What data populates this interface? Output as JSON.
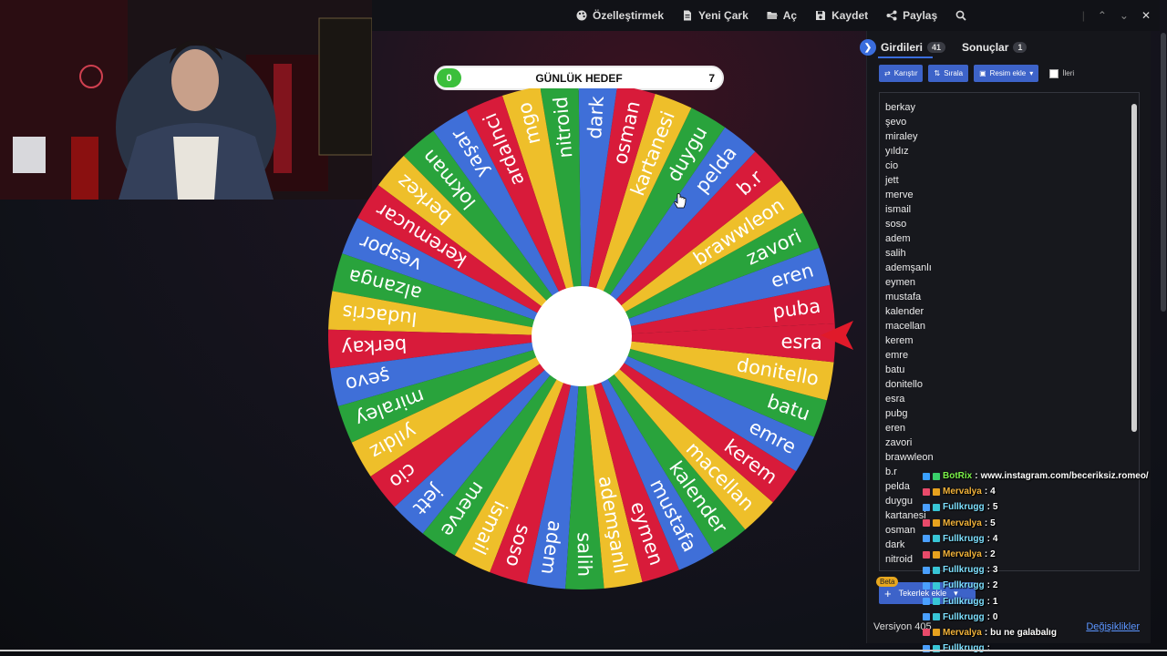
{
  "toolbar": {
    "items": [
      {
        "label": "Özelleştirmek",
        "icon": "palette-icon"
      },
      {
        "label": "Yeni Çark",
        "icon": "new-file-icon"
      },
      {
        "label": "Aç",
        "icon": "folder-open-icon"
      },
      {
        "label": "Kaydet",
        "icon": "save-icon"
      },
      {
        "label": "Paylaş",
        "icon": "share-icon"
      }
    ],
    "search_icon": "search-icon"
  },
  "goal": {
    "title": "GÜNLÜK HEDEF",
    "current": "0",
    "max": "7"
  },
  "wheel": {
    "segments": [
      "puba",
      "eren",
      "zavori",
      "brawwleon",
      "b.r",
      "pelda",
      "duygu",
      "kartanesi",
      "osman",
      "dark",
      "nitroid",
      "mgo",
      "ardalnci",
      "yaşar",
      "lokman",
      "berkez",
      "keremucar",
      "vespor",
      "alzanga",
      "ludacris",
      "berkay",
      "şevo",
      "miraley",
      "yıldız",
      "cio",
      "jett",
      "merve",
      "ismail",
      "soso",
      "adem",
      "salih",
      "ademşanlı",
      "eymen",
      "mustafa",
      "kalender",
      "macellan",
      "kerem",
      "emre",
      "batu",
      "donitello",
      "esra"
    ],
    "colors": {
      "blue": "#3f6fd8",
      "red": "#d81b3a",
      "yellow": "#eebf2a",
      "green": "#29a33c"
    },
    "pointer_color": "#e01a2a"
  },
  "panel": {
    "tabs": [
      {
        "label": "Girdileri",
        "count": "41"
      },
      {
        "label": "Sonuçlar",
        "count": "1"
      }
    ],
    "buttons": {
      "shuffle": "Karıştır",
      "sort": "Sırala",
      "add_image": "Resim ekle",
      "advanced": "İleri"
    },
    "entries": [
      "berkay",
      "şevo",
      "miraley",
      "yıldız",
      "cio",
      "jett",
      "merve",
      "ismail",
      "soso",
      "adem",
      "salih",
      "ademşanlı",
      "eymen",
      "mustafa",
      "kalender",
      "macellan",
      "kerem",
      "emre",
      "batu",
      "donitello",
      "esra",
      "pubg",
      "eren",
      "zavori",
      "brawwleon",
      "b.r",
      "pelda",
      "duygu",
      "kartanesi",
      "osman",
      "dark",
      "nitroid"
    ],
    "add_wheel": "Tekerlek ekle",
    "beta": "Beta",
    "version": "Versiyon 405",
    "changes": "Değişiklikler"
  },
  "chat": [
    {
      "user": "BotRix",
      "text": "www.instagram.com/beceriksiz.romeo/",
      "color": "#7cf34a"
    },
    {
      "user": "Mervalya",
      "text": "4",
      "color": "#f2b33a"
    },
    {
      "user": "Fullkrugg",
      "text": "5",
      "color": "#7ee0ff"
    },
    {
      "user": "Mervalya",
      "text": "5",
      "color": "#f2b33a"
    },
    {
      "user": "Fullkrugg",
      "text": "4",
      "color": "#7ee0ff"
    },
    {
      "user": "Mervalya",
      "text": "2",
      "color": "#f2b33a"
    },
    {
      "user": "Fullkrugg",
      "text": "3",
      "color": "#7ee0ff"
    },
    {
      "user": "Fullkrugg",
      "text": "2",
      "color": "#7ee0ff"
    },
    {
      "user": "Fullkrugg",
      "text": "1",
      "color": "#7ee0ff"
    },
    {
      "user": "Fullkrugg",
      "text": "0",
      "color": "#7ee0ff"
    },
    {
      "user": "Mervalya",
      "text": "bu ne galabalıg",
      "color": "#f2b33a"
    },
    {
      "user": "Fullkrugg",
      "text": "",
      "color": "#7ee0ff"
    }
  ]
}
